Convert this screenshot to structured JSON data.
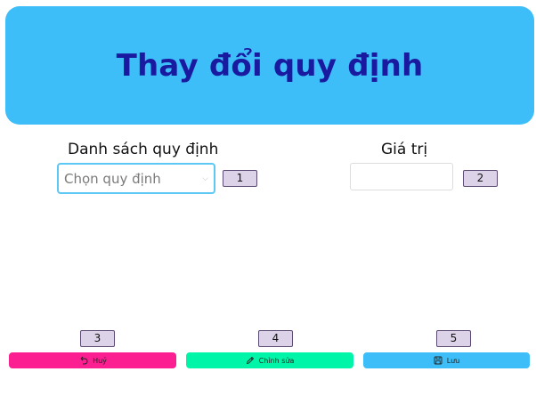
{
  "header": {
    "title": "Thay đổi quy định"
  },
  "form": {
    "rules_label": "Danh sách quy định",
    "rules_select_placeholder": "Chọn quy định",
    "value_label": "Giá trị",
    "value_input": ""
  },
  "markers": [
    "1",
    "2",
    "3",
    "4",
    "5"
  ],
  "actions": {
    "cancel": {
      "label": "Huỷ",
      "icon": "undo-icon",
      "color": "#fb1f91"
    },
    "edit": {
      "label": "Chỉnh sửa",
      "icon": "pencil-icon",
      "color": "#00f5a8"
    },
    "save": {
      "label": "Lưu",
      "icon": "save-icon",
      "color": "#3dbef8"
    }
  },
  "colors": {
    "header_bg": "#3dbef8",
    "header_text": "#1a1aa0",
    "select_border": "#5ec8f5",
    "marker_bg": "#dcd3e8"
  }
}
